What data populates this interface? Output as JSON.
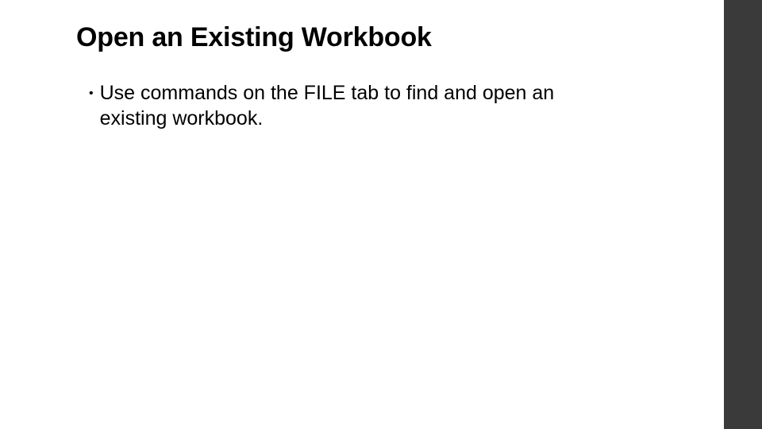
{
  "slide": {
    "title": "Open an Existing Workbook",
    "bullets": [
      {
        "text": "Use commands on the FILE tab to find and open an existing workbook."
      }
    ]
  }
}
